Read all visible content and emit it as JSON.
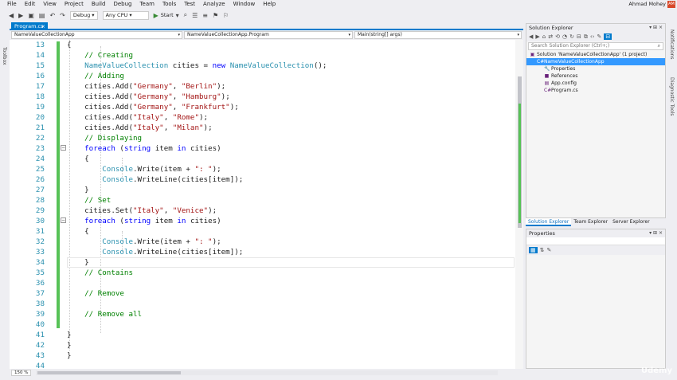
{
  "menu": [
    "File",
    "Edit",
    "View",
    "Project",
    "Build",
    "Debug",
    "Team",
    "Tools",
    "Test",
    "Analyze",
    "Window",
    "Help"
  ],
  "user": {
    "name": "Ahmad Mohey",
    "initials": "AM"
  },
  "toolbar": {
    "config": "Debug",
    "platform": "Any CPU",
    "start": "Start"
  },
  "left_rail": {
    "label": "Toolbox"
  },
  "right_rail": {
    "notifications": "Notifications",
    "diagnostic": "Diagnostic Tools"
  },
  "doc_tab": {
    "label": "Program.cs",
    "close": "×"
  },
  "navbar": {
    "project": "NameValueCollectionApp",
    "class": "NameValueCollectionApp.Program",
    "member": "Main(string[] args)"
  },
  "status": {
    "zoom": "150 %"
  },
  "code_lines": [
    {
      "n": "13",
      "html": "{"
    },
    {
      "n": "14",
      "html": "    <span class=\"cm\">// Creating</span>"
    },
    {
      "n": "15",
      "html": "    <span class=\"ty\">NameValueCollection</span> cities = <span class=\"kw\">new</span> <span class=\"ty\">NameValueCollection</span>();"
    },
    {
      "n": "16",
      "html": "    <span class=\"cm\">// Adding</span>"
    },
    {
      "n": "17",
      "html": "    cities.Add(<span class=\"str\">\"Germany\"</span>, <span class=\"str\">\"Berlin\"</span>);"
    },
    {
      "n": "18",
      "html": "    cities.Add(<span class=\"str\">\"Germany\"</span>, <span class=\"str\">\"Hamburg\"</span>);"
    },
    {
      "n": "19",
      "html": "    cities.Add(<span class=\"str\">\"Germany\"</span>, <span class=\"str\">\"Frankfurt\"</span>);"
    },
    {
      "n": "20",
      "html": "    cities.Add(<span class=\"str\">\"Italy\"</span>, <span class=\"str\">\"Rome\"</span>);"
    },
    {
      "n": "21",
      "html": "    cities.Add(<span class=\"str\">\"Italy\"</span>, <span class=\"str\">\"Milan\"</span>);"
    },
    {
      "n": "22",
      "html": "    <span class=\"cm\">// Displaying</span>"
    },
    {
      "n": "23",
      "html": "    <span class=\"kw\">foreach</span> (<span class=\"kw\">string</span> item <span class=\"kw\">in</span> cities)"
    },
    {
      "n": "24",
      "html": "    {"
    },
    {
      "n": "25",
      "html": "        <span class=\"ty\">Console</span>.Write(item + <span class=\"str\">\": \"</span>);"
    },
    {
      "n": "26",
      "html": "        <span class=\"ty\">Console</span>.WriteLine(cities[item]);"
    },
    {
      "n": "27",
      "html": "    }"
    },
    {
      "n": "28",
      "html": "    <span class=\"cm\">// Set</span>"
    },
    {
      "n": "29",
      "html": "    cities.Set(<span class=\"str\">\"Italy\"</span>, <span class=\"str\">\"Venice\"</span>);"
    },
    {
      "n": "30",
      "html": "    <span class=\"kw\">foreach</span> (<span class=\"kw\">string</span> item <span class=\"kw\">in</span> cities)"
    },
    {
      "n": "31",
      "html": "    {"
    },
    {
      "n": "32",
      "html": "        <span class=\"ty\">Console</span>.Write(item + <span class=\"str\">\": \"</span>);"
    },
    {
      "n": "33",
      "html": "        <span class=\"ty\">Console</span>.WriteLine(cities[item]);"
    },
    {
      "n": "34",
      "html": "    }"
    },
    {
      "n": "35",
      "html": "    <span class=\"cm\">// Contains</span>"
    },
    {
      "n": "36",
      "html": ""
    },
    {
      "n": "37",
      "html": "    <span class=\"cm\">// Remove</span>"
    },
    {
      "n": "38",
      "html": ""
    },
    {
      "n": "39",
      "html": "    <span class=\"cm\">// Remove all</span>"
    },
    {
      "n": "40",
      "html": ""
    },
    {
      "n": "41",
      "html": "}"
    },
    {
      "n": "42",
      "html": "}"
    },
    {
      "n": "43",
      "html": "}"
    },
    {
      "n": "44",
      "html": ""
    }
  ],
  "solution_explorer": {
    "title": "Solution Explorer",
    "search_placeholder": "Search Solution Explorer (Ctrl+;)",
    "tree": [
      {
        "label": "Solution 'NameValueCollectionApp' (1 project)",
        "indent": 0,
        "icon": "solution-icon",
        "sel": false
      },
      {
        "label": "NameValueCollectionApp",
        "indent": 1,
        "icon": "csharp-project-icon",
        "sel": true
      },
      {
        "label": "Properties",
        "indent": 2,
        "icon": "wrench-icon",
        "sel": false
      },
      {
        "label": "References",
        "indent": 2,
        "icon": "references-icon",
        "sel": false
      },
      {
        "label": "App.config",
        "indent": 2,
        "icon": "config-file-icon",
        "sel": false
      },
      {
        "label": "Program.cs",
        "indent": 2,
        "icon": "csharp-file-icon",
        "sel": false
      }
    ],
    "tabs": [
      "Solution Explorer",
      "Team Explorer",
      "Server Explorer"
    ]
  },
  "properties": {
    "title": "Properties"
  },
  "watermark": "Udemy"
}
